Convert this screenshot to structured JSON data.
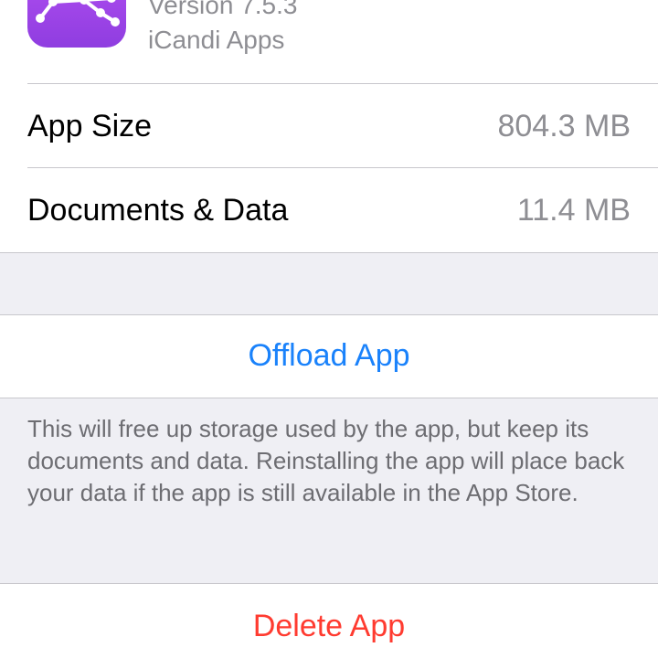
{
  "app": {
    "version": "Version 7.5.3",
    "developer": "iCandi Apps",
    "icon": "constellation-icon"
  },
  "storage": {
    "rows": [
      {
        "label": "App Size",
        "value": "804.3 MB"
      },
      {
        "label": "Documents & Data",
        "value": "11.4 MB"
      }
    ]
  },
  "actions": {
    "offload_label": "Offload App",
    "offload_footer": "This will free up storage used by the app, but keep its documents and data. Reinstalling the app will place back your data if the app is still available in the App Store.",
    "delete_label": "Delete App"
  },
  "colors": {
    "accent_blue": "#1a82fb",
    "destructive_red": "#ff3b30",
    "secondary_text": "#8e8e93",
    "group_background": "#efeff4",
    "icon_purple": "#a045ea"
  }
}
